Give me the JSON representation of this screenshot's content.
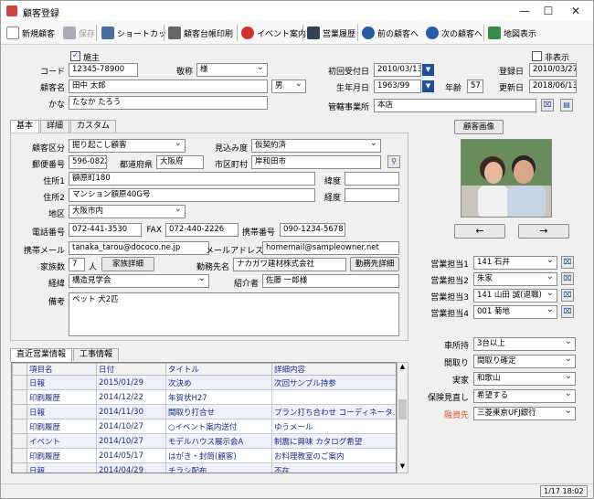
{
  "window": {
    "title": "顧客登録",
    "min": "—",
    "max": "☐",
    "close": "✕"
  },
  "toolbar": {
    "new": "新規顧客",
    "save": "保存",
    "shortcut": "ショートカット",
    "print": "顧客台帳印刷",
    "event": "イベント案内",
    "sales": "営業履歴",
    "prev": "前の顧客へ",
    "next": "次の顧客へ",
    "map": "地図表示"
  },
  "header": {
    "main_label": "施主",
    "hidden_label": "非表示",
    "code_label": "コード",
    "code": "12345-78900",
    "honorific_label": "敬称",
    "honorific": "様",
    "reception_label": "初回受付日",
    "reception": "2010/03/13",
    "registered_label": "登録日",
    "registered": "2010/03/27",
    "name_label": "顧客名",
    "name": "田中 太郎",
    "gender": "男",
    "birth_label": "生年月日",
    "birth": "1963/99",
    "age_label": "年齢",
    "age": "57",
    "updated_label": "更新日",
    "updated": "2018/06/13",
    "kana_label": "かな",
    "kana": "たなか たろう",
    "office_label": "管轄事業所",
    "office": "本店"
  },
  "tabs": [
    "基本",
    "詳細",
    "カスタム"
  ],
  "basic": {
    "category_label": "顧客区分",
    "category": "掘り起こし顧客",
    "prospect_label": "見込み度",
    "prospect": "仮契約済",
    "zip_label": "郵便番号",
    "zip": "596-0822",
    "pref_label": "都道府県",
    "pref": "大阪府",
    "city_label": "市区町村",
    "city": "岸和田市",
    "addr1_label": "住所1",
    "addr1": "額原町180",
    "addr2_label": "住所2",
    "addr2": "マンション額原40G号",
    "lat_label": "緯度",
    "lat": "",
    "lng_label": "経度",
    "lng": "",
    "area_label": "地区",
    "area": "大阪市内",
    "tel_label": "電話番号",
    "tel": "072-441-3530",
    "fax_label": "FAX",
    "fax": "072-440-2226",
    "mobile_label": "携帯番号",
    "mobile": "090-1234-5678",
    "mobile_mail_label": "携帯メール",
    "mobile_mail": "tanaka_tarou@dococo.ne.jp",
    "mail_label": "メールアドレス",
    "mail": "homemail@sampleowner.net",
    "family_label": "家族数",
    "family": "7",
    "family_unit": "人",
    "family_btn": "家族詳細",
    "work_label": "勤務先名",
    "work": "ナカガワ建材株式会社",
    "work_btn": "勤務先詳細",
    "route_label": "経緯",
    "route": "構造見学会",
    "referrer_label": "紹介者",
    "referrer": "佐藤 一郎様",
    "note_label": "備考",
    "note": "ペット 犬2匹"
  },
  "photo": {
    "button": "顧客画像",
    "prev": "←",
    "next": "→"
  },
  "sales_reps": [
    {
      "label": "営業担当1",
      "value": "141 石井"
    },
    {
      "label": "営業担当2",
      "value": "朱家"
    },
    {
      "label": "営業担当3",
      "value": "141 山田 誠(退職)"
    },
    {
      "label": "営業担当4",
      "value": "001 菊地"
    }
  ],
  "right_fields": [
    {
      "label": "車所持",
      "value": "3台以上"
    },
    {
      "label": "間取り",
      "value": "間取り確定"
    },
    {
      "label": "実家",
      "value": "和歌山"
    },
    {
      "label": "保険見直し",
      "value": "希望する"
    },
    {
      "label": "融資先",
      "value": "三菱東京UFJ銀行"
    }
  ],
  "bottom_tabs": [
    "直近営業情報",
    "工事情報"
  ],
  "grid": {
    "columns": [
      "項目名",
      "日付",
      "タイトル",
      "詳細内容"
    ],
    "rows": [
      [
        "日報",
        "2015/01/29",
        "次決め",
        "次回サンプル持参"
      ],
      [
        "印刷履歴",
        "2014/12/22",
        "年賀状H27",
        ""
      ],
      [
        "日報",
        "2014/11/30",
        "間取り打合せ",
        "プラン打ち合わせ コーディネータ.."
      ],
      [
        "印刷履歴",
        "2014/10/27",
        "○イベント案内送付",
        "ゆうメール"
      ],
      [
        "イベント",
        "2014/10/27",
        "モデルハウス展示会A",
        "制震に興味 カタログ希望"
      ],
      [
        "印刷履歴",
        "2014/05/17",
        "はがき・封筒(顧客)",
        "お料理教室のご案内"
      ],
      [
        "日報",
        "2014/04/29",
        "チラシ配布",
        "不在"
      ]
    ]
  },
  "status": {
    "text": "1/17 18:02"
  },
  "colors": {
    "accent": "#1e4f99",
    "red_label": "#e0502a"
  }
}
